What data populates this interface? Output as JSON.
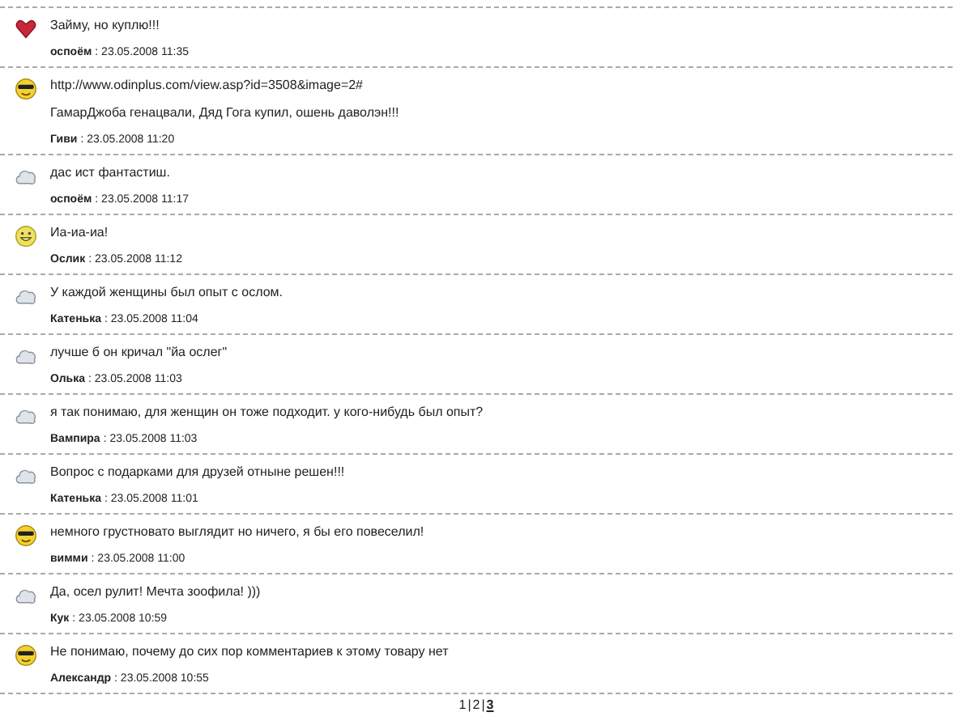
{
  "comments": [
    {
      "kind": "heart",
      "messages": [
        "Займу, но куплю!!!"
      ],
      "author": "оспоём",
      "date": ": 23.05.2008 11:35"
    },
    {
      "kind": "cool",
      "messages": [
        "http://www.odinplus.com/view.asp?id=3508&image=2#",
        "ГамарДжоба генацвали, Дяд Гога купил, ошень даволэн!!!"
      ],
      "author": "Гиви",
      "date": ": 23.05.2008 11:20"
    },
    {
      "kind": "cloud",
      "messages": [
        "дас ист фантастиш."
      ],
      "author": "оспоём",
      "date": ": 23.05.2008 11:17"
    },
    {
      "kind": "grin",
      "messages": [
        "Иа-иа-иа!"
      ],
      "author": "Ослик",
      "date": ": 23.05.2008 11:12"
    },
    {
      "kind": "cloud",
      "messages": [
        "У каждой женщины был опыт с ослом."
      ],
      "author": "Катенька",
      "date": ": 23.05.2008 11:04"
    },
    {
      "kind": "cloud",
      "messages": [
        "лучше б он кричал \"йа ослег\""
      ],
      "author": "Олька",
      "date": ": 23.05.2008 11:03"
    },
    {
      "kind": "cloud",
      "messages": [
        "я так понимаю, для женщин он тоже подходит. у кого-нибудь был опыт?"
      ],
      "author": "Вампира",
      "date": ": 23.05.2008 11:03"
    },
    {
      "kind": "cloud",
      "messages": [
        "Вопрос с подарками для друзей отныне решен!!!"
      ],
      "author": "Катенька",
      "date": ": 23.05.2008 11:01"
    },
    {
      "kind": "cool",
      "messages": [
        "немного грустновато выглядит но ничего, я бы его повеселил!"
      ],
      "author": "вимми",
      "date": ": 23.05.2008 11:00"
    },
    {
      "kind": "cloud",
      "messages": [
        "Да, осел рулит! Мечта зоофила! )))"
      ],
      "author": "Кук",
      "date": ": 23.05.2008 10:59"
    },
    {
      "kind": "cool",
      "messages": [
        "Не понимаю, почему до сих пор комментариев к этому товару нет"
      ],
      "author": "Александр",
      "date": ": 23.05.2008 10:55"
    }
  ],
  "pagination": {
    "separator": "|",
    "pages": [
      {
        "label": "1",
        "selected": false
      },
      {
        "label": "2",
        "selected": false
      },
      {
        "label": "3",
        "selected": true
      }
    ]
  }
}
